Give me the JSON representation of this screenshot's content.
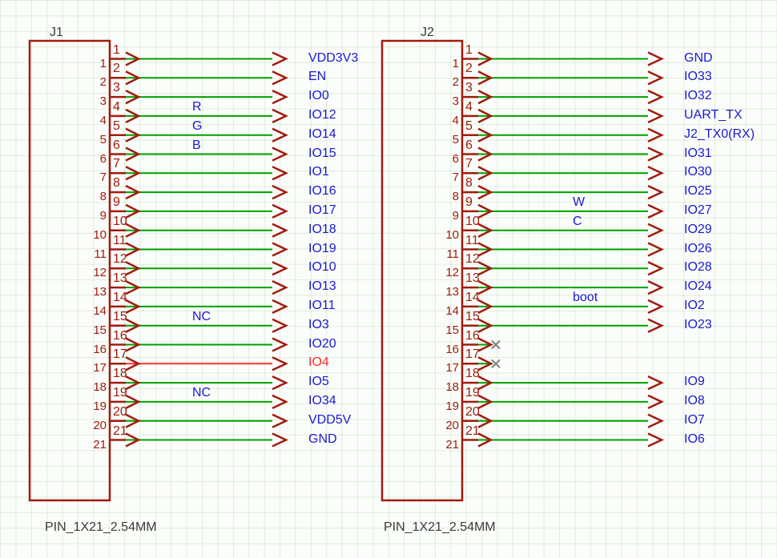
{
  "left": {
    "ref": "J1",
    "footprint": "PIN_1X21_2.54MM",
    "pins": [
      {
        "n": "1",
        "net": "VDD3V3"
      },
      {
        "n": "2",
        "net": "EN"
      },
      {
        "n": "3",
        "net": "IO0"
      },
      {
        "n": "4",
        "net": "IO12",
        "mid": "R"
      },
      {
        "n": "5",
        "net": "IO14",
        "mid": "G"
      },
      {
        "n": "6",
        "net": "IO15",
        "mid": "B"
      },
      {
        "n": "7",
        "net": "IO1"
      },
      {
        "n": "8",
        "net": "IO16"
      },
      {
        "n": "9",
        "net": "IO17"
      },
      {
        "n": "10",
        "net": "IO18"
      },
      {
        "n": "11",
        "net": "IO19"
      },
      {
        "n": "12",
        "net": "IO10"
      },
      {
        "n": "13",
        "net": "IO13"
      },
      {
        "n": "14",
        "net": "IO11"
      },
      {
        "n": "15",
        "net": "IO3",
        "mid": "NC"
      },
      {
        "n": "16",
        "net": "IO20"
      },
      {
        "n": "17",
        "net": "IO4",
        "io4": true
      },
      {
        "n": "18",
        "net": "IO5"
      },
      {
        "n": "19",
        "net": "IO34",
        "mid": "NC"
      },
      {
        "n": "20",
        "net": "VDD5V"
      },
      {
        "n": "21",
        "net": "GND"
      }
    ]
  },
  "right": {
    "ref": "J2",
    "footprint": "PIN_1X21_2.54MM",
    "pins": [
      {
        "n": "1",
        "net": "GND"
      },
      {
        "n": "2",
        "net": "IO33"
      },
      {
        "n": "3",
        "net": "IO32"
      },
      {
        "n": "4",
        "net": "UART_TX"
      },
      {
        "n": "5",
        "net": "J2_TX0(RX)"
      },
      {
        "n": "6",
        "net": "IO31"
      },
      {
        "n": "7",
        "net": "IO30"
      },
      {
        "n": "8",
        "net": "IO25"
      },
      {
        "n": "9",
        "net": "IO27",
        "mid": "W"
      },
      {
        "n": "10",
        "net": "IO29",
        "mid": "C"
      },
      {
        "n": "11",
        "net": "IO26"
      },
      {
        "n": "12",
        "net": "IO28"
      },
      {
        "n": "13",
        "net": "IO24"
      },
      {
        "n": "14",
        "net": "IO2",
        "mid": "boot"
      },
      {
        "n": "15",
        "net": "IO23"
      },
      {
        "n": "16",
        "nc": true
      },
      {
        "n": "17",
        "nc": true
      },
      {
        "n": "18",
        "net": "IO9"
      },
      {
        "n": "19",
        "net": "IO8"
      },
      {
        "n": "20",
        "net": "IO7"
      },
      {
        "n": "21",
        "net": "IO6"
      }
    ]
  },
  "colors": {
    "body": "#a11b0f",
    "wire": "#00a000",
    "net": "#1a1ad0",
    "io4": "#ff3333",
    "grid": "#c8e0c8"
  }
}
